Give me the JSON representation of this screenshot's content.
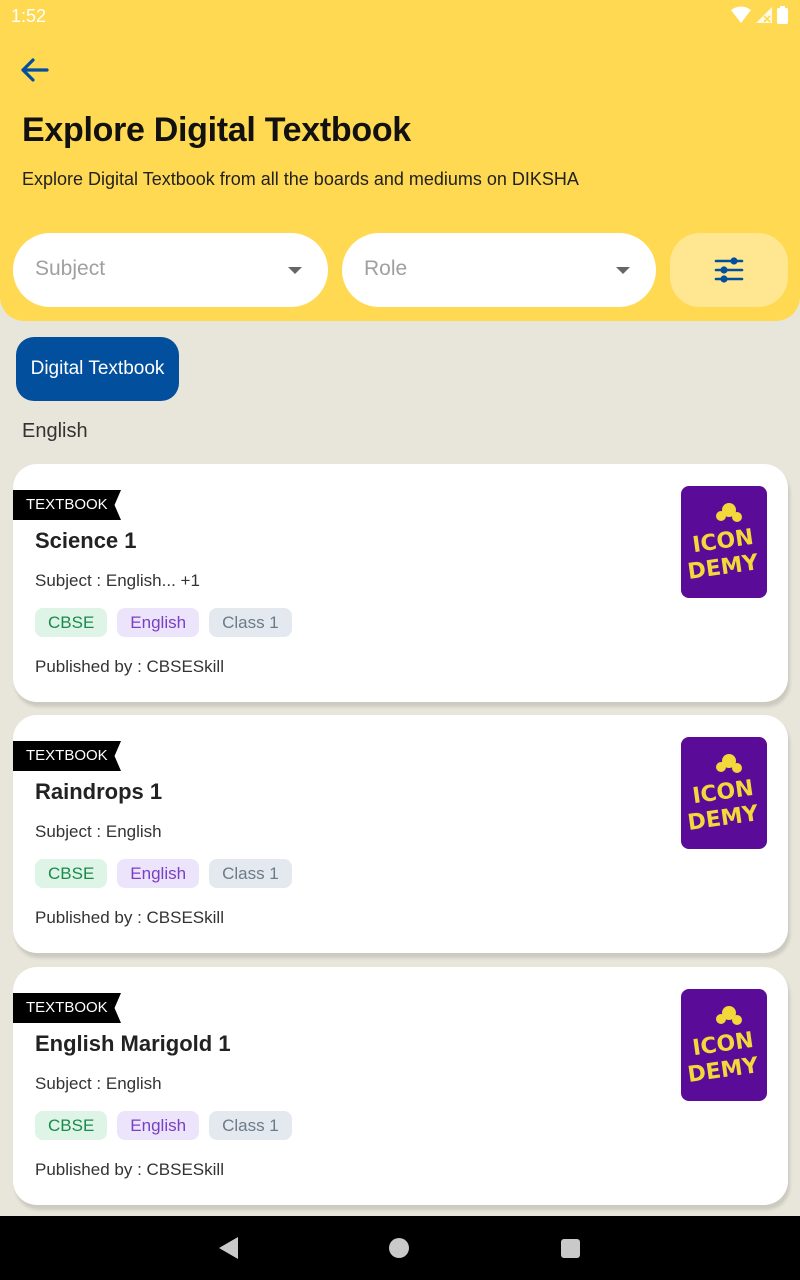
{
  "status_bar": {
    "time": "1:52"
  },
  "header": {
    "title": "Explore Digital Textbook",
    "subtitle": "Explore Digital Textbook from all the boards and mediums on DIKSHA"
  },
  "filters": {
    "subject_placeholder": "Subject",
    "role_placeholder": "Role"
  },
  "primary_category_chip": "Digital Textbook",
  "section_heading": "English",
  "cards": [
    {
      "badge": "TEXTBOOK",
      "title": "Science 1",
      "subject": "Subject : English... +1",
      "tags": [
        "CBSE",
        "English",
        "Class 1"
      ],
      "publisher": "Published by : CBSESkill"
    },
    {
      "badge": "TEXTBOOK",
      "title": "Raindrops 1",
      "subject": "Subject : English",
      "tags": [
        "CBSE",
        "English",
        "Class 1"
      ],
      "publisher": "Published by : CBSESkill"
    },
    {
      "badge": "TEXTBOOK",
      "title": "English Marigold 1",
      "subject": "Subject : English",
      "tags": [
        "CBSE",
        "English",
        "Class 1"
      ],
      "publisher": "Published by : CBSESkill"
    }
  ],
  "thumbnail_logo_text": "ICON DEMY",
  "colors": {
    "header_bg": "#ffd952",
    "primary": "#024f9d",
    "page_bg": "#e8e6da",
    "thumbnail_bg": "#5a0b97"
  }
}
